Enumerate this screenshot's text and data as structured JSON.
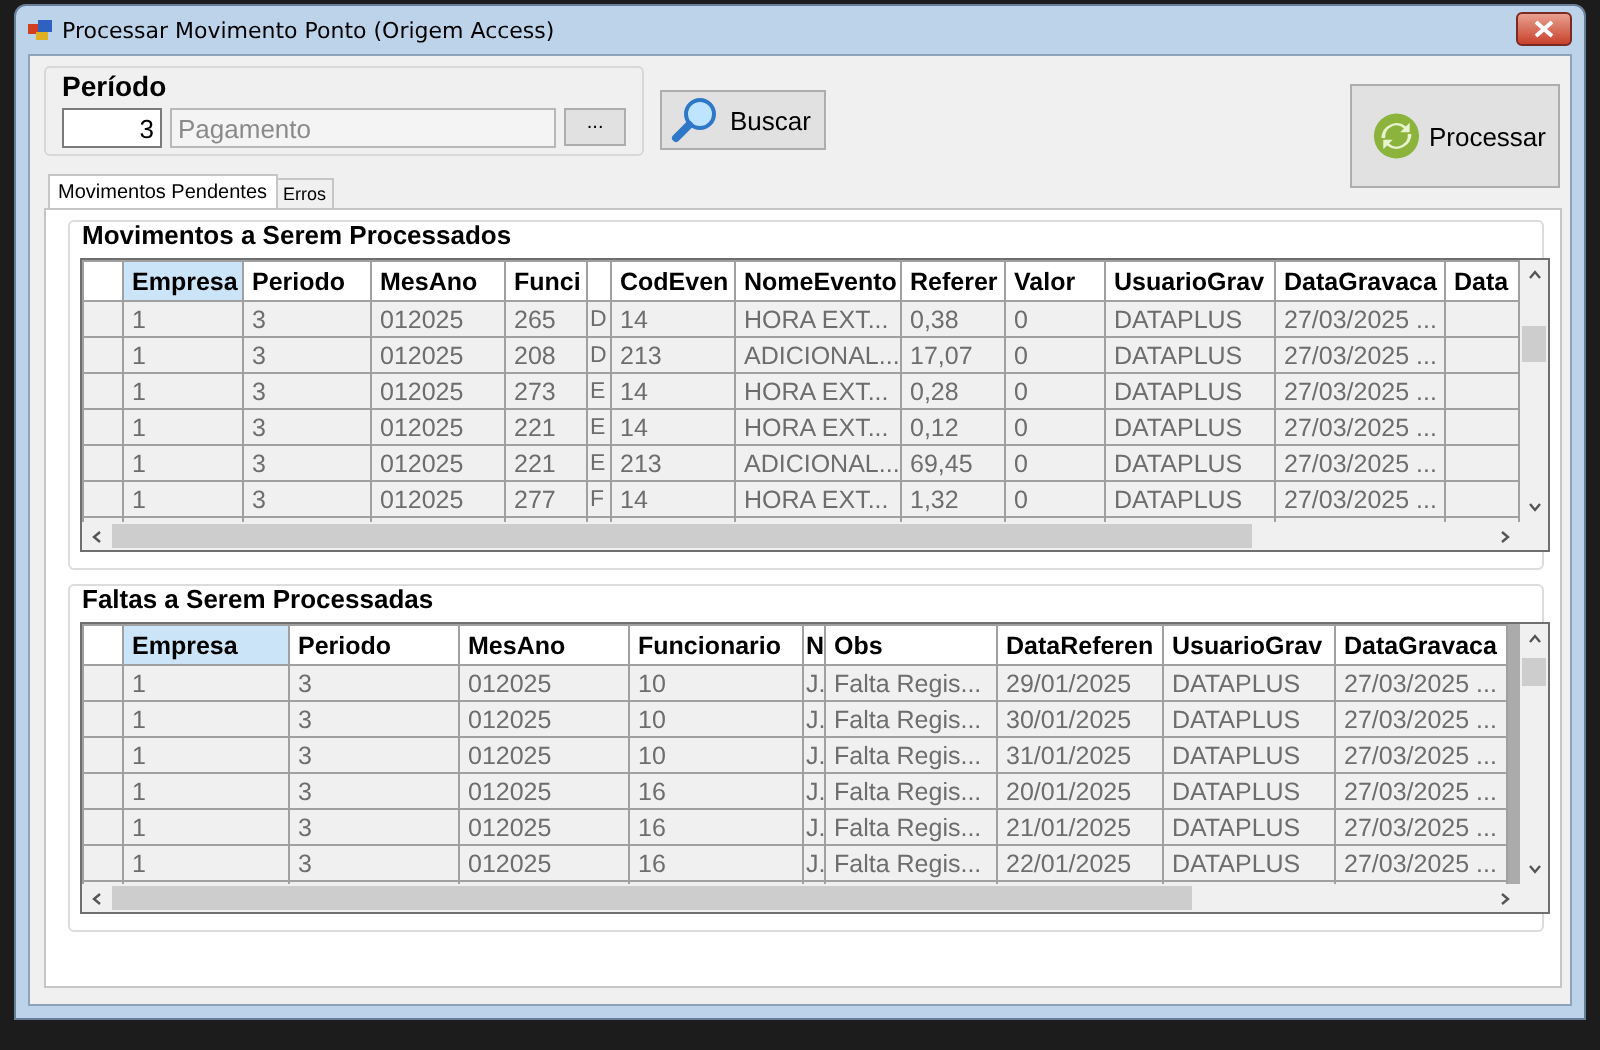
{
  "window": {
    "title": "Processar Movimento Ponto (Origem Access)"
  },
  "period": {
    "label": "Período",
    "number": "3",
    "description": {
      "value": "Pagamento",
      "disabled": true
    },
    "lookup_button": "..."
  },
  "search_button": "Buscar",
  "process_button": "Processar",
  "tabs": [
    {
      "label": "Movimentos Pendentes",
      "selected": true
    },
    {
      "label": "Erros",
      "selected": false
    }
  ],
  "movements": {
    "title": "Movimentos a Serem Processados",
    "table": {
      "columns": [
        {
          "label": "Empresa",
          "selected": true
        },
        {
          "label": "Periodo",
          "selected": false
        },
        {
          "label": "MesAno",
          "selected": false
        },
        {
          "label": "Funci",
          "selected": false
        },
        {
          "selected": false
        },
        {
          "label": "CodEven",
          "selected": false
        },
        {
          "label": "NomeEvento",
          "selected": false
        },
        {
          "label": "Referer",
          "selected": false
        },
        {
          "label": "Valor",
          "selected": false
        },
        {
          "label": "UsuarioGrav",
          "selected": false
        },
        {
          "label": "DataGravaca",
          "selected": false
        },
        {
          "label": "Data",
          "selected": false
        }
      ],
      "rows": [
        [
          "1",
          "3",
          "012025",
          "265",
          "D",
          "14",
          "HORA EXT...",
          "0,38",
          "0",
          "DATAPLUS",
          "27/03/2025 ..."
        ],
        [
          "1",
          "3",
          "012025",
          "208",
          "D",
          "213",
          "ADICIONAL...",
          "17,07",
          "0",
          "DATAPLUS",
          "27/03/2025 ..."
        ],
        [
          "1",
          "3",
          "012025",
          "273",
          "E",
          "14",
          "HORA EXT...",
          "0,28",
          "0",
          "DATAPLUS",
          "27/03/2025 ..."
        ],
        [
          "1",
          "3",
          "012025",
          "221",
          "E",
          "14",
          "HORA EXT...",
          "0,12",
          "0",
          "DATAPLUS",
          "27/03/2025 ..."
        ],
        [
          "1",
          "3",
          "012025",
          "221",
          "E",
          "213",
          "ADICIONAL...",
          "69,45",
          "0",
          "DATAPLUS",
          "27/03/2025 ..."
        ],
        [
          "1",
          "3",
          "012025",
          "277",
          "F",
          "14",
          "HORA EXT...",
          "1,32",
          "0",
          "DATAPLUS",
          "27/03/2025 ..."
        ]
      ]
    }
  },
  "absences": {
    "title": "Faltas a Serem Processadas",
    "table": {
      "columns": [
        {
          "label": "Empresa",
          "selected": true
        },
        {
          "label": "Periodo",
          "selected": false
        },
        {
          "label": "MesAno",
          "selected": false
        },
        {
          "label": "Funcionario",
          "selected": false
        },
        {
          "label": "N",
          "selected": false
        },
        {
          "label": "Obs",
          "selected": false
        },
        {
          "label": "DataReferen",
          "selected": false
        },
        {
          "label": "UsuarioGrav",
          "selected": false
        },
        {
          "label": "DataGravaca",
          "selected": false
        }
      ],
      "rows": [
        [
          "1",
          "3",
          "012025",
          "10",
          "J.",
          "Falta Regis...",
          "29/01/2025",
          "DATAPLUS",
          "27/03/2025 ..."
        ],
        [
          "1",
          "3",
          "012025",
          "10",
          "J.",
          "Falta Regis...",
          "30/01/2025",
          "DATAPLUS",
          "27/03/2025 ..."
        ],
        [
          "1",
          "3",
          "012025",
          "10",
          "J.",
          "Falta Regis...",
          "31/01/2025",
          "DATAPLUS",
          "27/03/2025 ..."
        ],
        [
          "1",
          "3",
          "012025",
          "16",
          "J.",
          "Falta Regis...",
          "20/01/2025",
          "DATAPLUS",
          "27/03/2025 ..."
        ],
        [
          "1",
          "3",
          "012025",
          "16",
          "J.",
          "Falta Regis...",
          "21/01/2025",
          "DATAPLUS",
          "27/03/2025 ..."
        ],
        [
          "1",
          "3",
          "012025",
          "16",
          "J.",
          "Falta Regis...",
          "22/01/2025",
          "DATAPLUS",
          "27/03/2025 ..."
        ]
      ]
    }
  }
}
